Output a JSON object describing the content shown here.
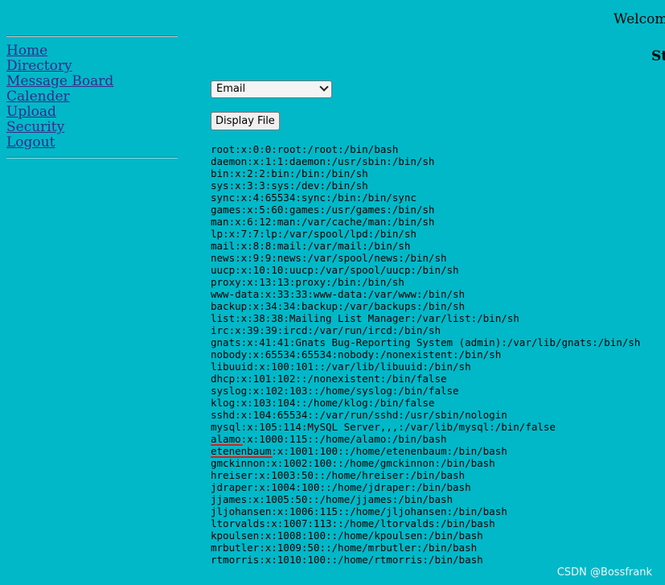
{
  "header": {
    "welcome_text": "Welcom",
    "subheading": "St"
  },
  "nav": {
    "items": [
      {
        "label": "Home"
      },
      {
        "label": "Directory"
      },
      {
        "label": "Message Board"
      },
      {
        "label": "Calender"
      },
      {
        "label": "Upload"
      },
      {
        "label": "Security"
      },
      {
        "label": "Logout"
      }
    ]
  },
  "form": {
    "select_value": "Email",
    "button_label": "Display File"
  },
  "file_lines": [
    "root:x:0:0:root:/root:/bin/bash",
    "daemon:x:1:1:daemon:/usr/sbin:/bin/sh",
    "bin:x:2:2:bin:/bin:/bin/sh",
    "sys:x:3:3:sys:/dev:/bin/sh",
    "sync:x:4:65534:sync:/bin:/bin/sync",
    "games:x:5:60:games:/usr/games:/bin/sh",
    "man:x:6:12:man:/var/cache/man:/bin/sh",
    "lp:x:7:7:lp:/var/spool/lpd:/bin/sh",
    "mail:x:8:8:mail:/var/mail:/bin/sh",
    "news:x:9:9:news:/var/spool/news:/bin/sh",
    "uucp:x:10:10:uucp:/var/spool/uucp:/bin/sh",
    "proxy:x:13:13:proxy:/bin:/bin/sh",
    "www-data:x:33:33:www-data:/var/www:/bin/sh",
    "backup:x:34:34:backup:/var/backups:/bin/sh",
    "list:x:38:38:Mailing List Manager:/var/list:/bin/sh",
    "irc:x:39:39:ircd:/var/run/ircd:/bin/sh",
    "gnats:x:41:41:Gnats Bug-Reporting System (admin):/var/lib/gnats:/bin/sh",
    "nobody:x:65534:65534:nobody:/nonexistent:/bin/sh",
    "libuuid:x:100:101::/var/lib/libuuid:/bin/sh",
    "dhcp:x:101:102::/nonexistent:/bin/false",
    "syslog:x:102:103::/home/syslog:/bin/false",
    "klog:x:103:104::/home/klog:/bin/false",
    "sshd:x:104:65534::/var/run/sshd:/usr/sbin/nologin",
    "mysql:x:105:114:MySQL Server,,,:/var/lib/mysql:/bin/false",
    "alamo:x:1000:115::/home/alamo:/bin/bash",
    "etenenbaum:x:1001:100::/home/etenenbaum:/bin/bash",
    "gmckinnon:x:1002:100::/home/gmckinnon:/bin/bash",
    "hreiser:x:1003:50::/home/hreiser:/bin/bash",
    "jdraper:x:1004:100::/home/jdraper:/bin/bash",
    "jjames:x:1005:50::/home/jjames:/bin/bash",
    "jljohansen:x:1006:115::/home/jljohansen:/bin/bash",
    "ltorvalds:x:1007:113::/home/ltorvalds:/bin/bash",
    "kpoulsen:x:1008:100::/home/kpoulsen:/bin/bash",
    "mrbutler:x:1009:50::/home/mrbutler:/bin/bash",
    "rtmorris:x:1010:100::/home/rtmorris:/bin/bash"
  ],
  "annotations": {
    "underline_color": "#d42020",
    "underlined_users": [
      "alamo",
      "etenenbaum"
    ]
  },
  "watermark": "CSDN @Bossfrank"
}
